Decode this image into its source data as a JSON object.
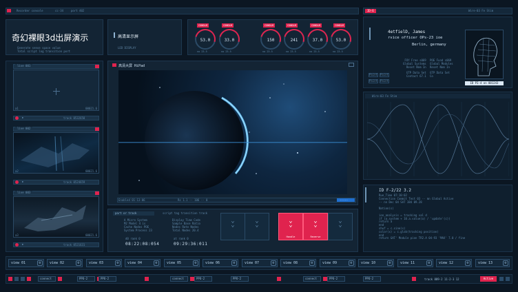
{
  "header": {
    "left_title": "Recorder console",
    "left_sub1": "cc-34",
    "left_sub2": "port 402",
    "right_tag": "ID-6",
    "right_title": "Wire-03 Fe Stim"
  },
  "title_panel": {
    "title": "奇幻裸眼3d出屏演示",
    "desc1": "Generate sense space value",
    "desc2": "Total script log transition port"
  },
  "display_panel": {
    "title": "高清显示屏",
    "sub": "LED DISPLAY"
  },
  "gauges": [
    {
      "tag": "CONDLM",
      "value": "53.0",
      "sub": "no 23.5"
    },
    {
      "tag": "CONDLM",
      "value": "33.0",
      "sub": "no 23.5"
    },
    {
      "tag": "CONDLM",
      "value": "150",
      "sub": "no 23.5"
    },
    {
      "tag": "CONDLM",
      "value": "241",
      "sub": "no 23.5"
    },
    {
      "tag": "CONDLM",
      "value": "37.0",
      "sub": "no 23.5"
    },
    {
      "tag": "CONDLM",
      "value": "53.0",
      "sub": "no 23.5"
    }
  ],
  "thumbs": [
    {
      "tag": "live 001",
      "track": "track 0532658",
      "note1": "a1",
      "note2": "00021.6"
    },
    {
      "tag": "live 002",
      "track": "track 0524659",
      "note1": "a2",
      "note2": "00021.6"
    },
    {
      "tag": "live 003",
      "track": "track 0521631",
      "note1": "a3",
      "note2": "00021.6"
    }
  ],
  "main_view": {
    "title": "高清大屏 HiPad",
    "status_left": "Enabled 01-13-06",
    "status_mid": "Rs 1.1 -- 106 -- 0",
    "status_btn": "-----"
  },
  "profile": {
    "name": "4etfielD, James",
    "role": "rvice officer OPs-23 ioe",
    "city": "Berlin, germany",
    "l1": "FOY Free s069",
    "l2": "Global Systems",
    "l3": "Reset Nom In",
    "r1": "POE Fund s069",
    "r2": "Global Modules",
    "r3": "Reset Nom In",
    "l4": "GTP Data Set",
    "r4": "GTP Data Set",
    "l5": "Contact 67.1",
    "r5": "Co",
    "btn1": "Paint",
    "btn2": "Paint",
    "btn3": "Paint",
    "btn4": "Paint",
    "caption": "ID PI-4 on 001243"
  },
  "wave_panel": {
    "title": "Wire-03 Fe Stim"
  },
  "code_panel": {
    "title": "ID F-2/22 3.2",
    "lines": [
      "Rue_Time 07:10:02",
      "Connection Commit Test 03   -- mn Global Active",
      "                            -- nn Dec 04 SAT 384 09.28",
      "",
      "Nation(s)",
      "",
      "  ion_analysis = tracking val d",
      "    if (a.system + 10.a.value(a) / 'update'(c))",
      "      return a",
      "    end",
      "    shuf = c.sine(s)",
      "    color(x) = c.glob(tracking position)",
      "  end",
      "  return GAT' Module pion TR2.A 04-93 'MAX' 7.0 / fine"
    ]
  },
  "track_panel": {
    "tag": "part or track",
    "title": "script tag transition track",
    "col1": [
      "A Micro System",
      "M2 Model 4 is",
      "Cache Nodes POE",
      "System Process 23"
    ],
    "col2": [
      "Display Time Code",
      "Sample Base Ratio",
      "Nodes Rate Nodes",
      "Total Nodes 20.4"
    ],
    "time1": "08:22:08:054",
    "time2": "09:29:36:011",
    "t1lbl": "d0 rank 0",
    "t2lbl": "at rank 0"
  },
  "chevrons": [
    {
      "label": ""
    },
    {
      "label": ""
    },
    {
      "label": "Handle"
    },
    {
      "label": "Reverse"
    },
    {
      "label": ""
    }
  ],
  "views": [
    "view 01",
    "view 02",
    "view 03",
    "view 04",
    "view 05",
    "view 06",
    "view 07",
    "view 08",
    "view 09",
    "view 10",
    "view 11",
    "view 12",
    "view 13"
  ],
  "footer": {
    "items": [
      "connect",
      "PPO-2",
      "PPO-2",
      "connect",
      "PPO-2",
      "PPO-2",
      "connect",
      "PPO-2",
      "PPO-2"
    ],
    "track": "track 889-2 11-2-3 12",
    "status": "Active"
  }
}
